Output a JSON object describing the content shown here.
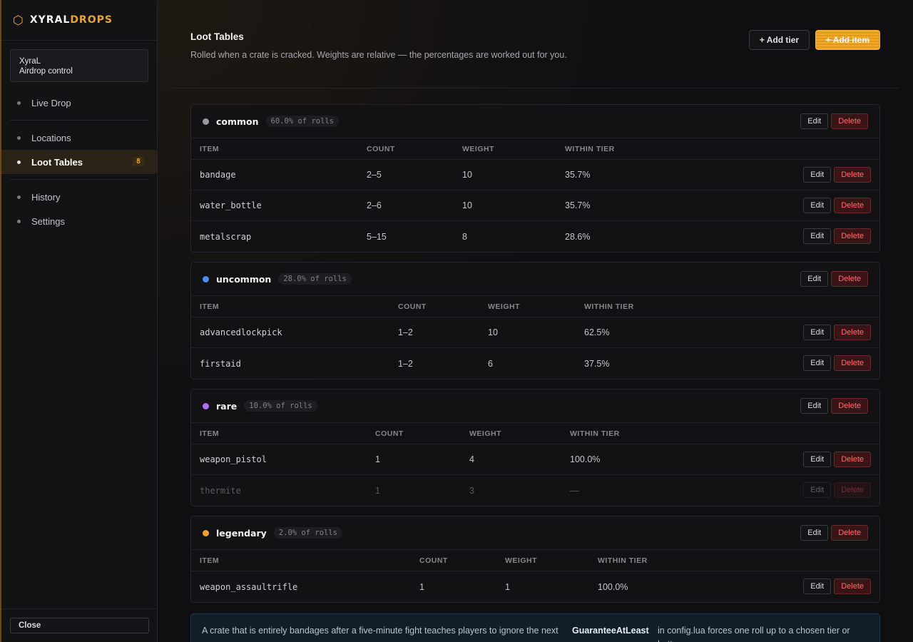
{
  "brand": {
    "part1": "XYRAL",
    "part2": "DROPS"
  },
  "user": {
    "name": "XyraL",
    "role": "Airdrop control"
  },
  "nav": [
    {
      "label": "Live Drop"
    },
    {
      "label": "Locations"
    },
    {
      "label": "Loot Tables",
      "badge": "8",
      "active": true
    },
    {
      "label": "History"
    },
    {
      "label": "Settings"
    }
  ],
  "close_label": "Close",
  "header": {
    "title": "Loot Tables",
    "subtitle": "Rolled when a crate is cracked. Weights are relative — the percentages are worked out for you.",
    "add_tier": "+ Add tier",
    "add_item": "+ Add item"
  },
  "labels": {
    "edit": "Edit",
    "delete": "Delete"
  },
  "columns": {
    "item": "ITEM",
    "count": "COUNT",
    "weight": "WEIGHT",
    "within": "WITHIN TIER"
  },
  "tiers": [
    {
      "name": "common",
      "pct": "60.0% of rolls",
      "color": "#9a9aa2",
      "rows": [
        {
          "item": "bandage",
          "count": "2–5",
          "weight": "10",
          "within": "35.7%"
        },
        {
          "item": "water_bottle",
          "count": "2–6",
          "weight": "10",
          "within": "35.7%"
        },
        {
          "item": "metalscrap",
          "count": "5–15",
          "weight": "8",
          "within": "28.6%"
        }
      ]
    },
    {
      "name": "uncommon",
      "pct": "28.0% of rolls",
      "color": "#4a8ef0",
      "rows": [
        {
          "item": "advancedlockpick",
          "count": "1–2",
          "weight": "10",
          "within": "62.5%"
        },
        {
          "item": "firstaid",
          "count": "1–2",
          "weight": "6",
          "within": "37.5%"
        }
      ]
    },
    {
      "name": "rare",
      "pct": "10.0% of rolls",
      "color": "#b06ef0",
      "rows": [
        {
          "item": "weapon_pistol",
          "count": "1",
          "weight": "4",
          "within": "100.0%"
        },
        {
          "item": "thermite",
          "count": "1",
          "weight": "3",
          "within": "—",
          "disabled": true
        }
      ]
    },
    {
      "name": "legendary",
      "pct": "2.0% of rolls",
      "color": "#f0a030",
      "rows": [
        {
          "item": "weapon_assaultrifle",
          "count": "1",
          "weight": "1",
          "within": "100.0%"
        }
      ]
    }
  ],
  "notice": {
    "text1": "A crate that is entirely bandages after a five-minute fight teaches players to ignore the next one.",
    "keyword": "GuaranteeAtLeast",
    "text2": "in config.lua forces one roll up to a chosen tier or better."
  }
}
